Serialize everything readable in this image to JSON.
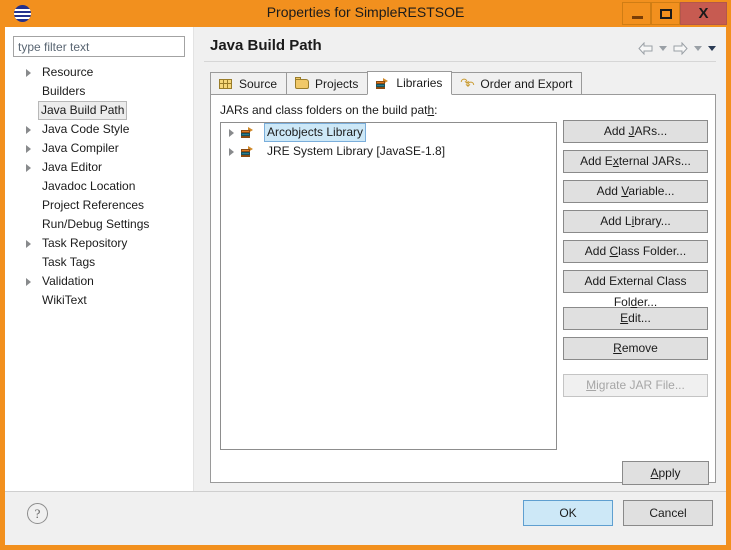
{
  "window": {
    "title": "Properties for SimpleRESTSOE",
    "app_icon": "eclipse-icon",
    "minimize_label": "–",
    "maximize_label": "",
    "close_label": "X"
  },
  "sidebar": {
    "filter": {
      "placeholder": "type filter text",
      "value": ""
    },
    "items": [
      {
        "label": "Resource",
        "expandable": true,
        "selected": false
      },
      {
        "label": "Builders",
        "expandable": false,
        "selected": false
      },
      {
        "label": "Java Build Path",
        "expandable": false,
        "selected": true
      },
      {
        "label": "Java Code Style",
        "expandable": true,
        "selected": false
      },
      {
        "label": "Java Compiler",
        "expandable": true,
        "selected": false
      },
      {
        "label": "Java Editor",
        "expandable": true,
        "selected": false
      },
      {
        "label": "Javadoc Location",
        "expandable": false,
        "selected": false
      },
      {
        "label": "Project References",
        "expandable": false,
        "selected": false
      },
      {
        "label": "Run/Debug Settings",
        "expandable": false,
        "selected": false
      },
      {
        "label": "Task Repository",
        "expandable": true,
        "selected": false
      },
      {
        "label": "Task Tags",
        "expandable": false,
        "selected": false
      },
      {
        "label": "Validation",
        "expandable": true,
        "selected": false
      },
      {
        "label": "WikiText",
        "expandable": false,
        "selected": false
      }
    ]
  },
  "main": {
    "page_title": "Java Build Path",
    "nav": {
      "back_icon": "back-arrow-icon",
      "back_menu_icon": "chevron-down-icon",
      "forward_icon": "forward-arrow-icon",
      "forward_menu_icon": "chevron-down-icon",
      "view_menu_icon": "chevron-down-icon"
    },
    "tabs": [
      {
        "label": "Source",
        "icon": "package-icon",
        "active": false
      },
      {
        "label": "Projects",
        "icon": "folder-icon",
        "active": false
      },
      {
        "label": "Libraries",
        "icon": "books-icon",
        "active": true
      },
      {
        "label": "Order and Export",
        "icon": "order-export-icon",
        "active": false
      }
    ],
    "jars_label_prefix": "JARs and class folders on the build pat",
    "jars_label_mnemonic": "h",
    "jars_label_suffix": ":",
    "libraries": [
      {
        "name": "Arcobjects Library",
        "icon": "library-icon",
        "expandable": true,
        "selected": true
      },
      {
        "name": "JRE System Library [JavaSE-1.8]",
        "icon": "library-icon",
        "expandable": true,
        "selected": false
      }
    ],
    "buttons": [
      {
        "pre": "Add ",
        "mnemonic": "J",
        "post": "ARs...",
        "enabled": true
      },
      {
        "pre": "Add E",
        "mnemonic": "x",
        "post": "ternal JARs...",
        "enabled": true
      },
      {
        "pre": "Add ",
        "mnemonic": "V",
        "post": "ariable...",
        "enabled": true
      },
      {
        "pre": "Add L",
        "mnemonic": "i",
        "post": "brary...",
        "enabled": true
      },
      {
        "pre": "Add ",
        "mnemonic": "C",
        "post": "lass Folder...",
        "enabled": true
      },
      {
        "pre": "Add External Class Fol",
        "mnemonic": "d",
        "post": "er...",
        "enabled": true
      },
      {
        "pre": "",
        "mnemonic": "E",
        "post": "dit...",
        "enabled": true
      },
      {
        "pre": "",
        "mnemonic": "R",
        "post": "emove",
        "enabled": true
      },
      {
        "pre": "",
        "mnemonic": "M",
        "post": "igrate JAR File...",
        "enabled": false
      }
    ],
    "apply": {
      "pre": "",
      "mnemonic": "A",
      "post": "pply"
    }
  },
  "footer": {
    "help_icon": "help-icon",
    "help_glyph": "?",
    "ok_label": "OK",
    "cancel_label": "Cancel"
  },
  "colors": {
    "window_frame": "#f2901e",
    "close_button": "#c75b51",
    "selection": "#cde8f7",
    "dialog_bg": "#f0f0f0"
  }
}
